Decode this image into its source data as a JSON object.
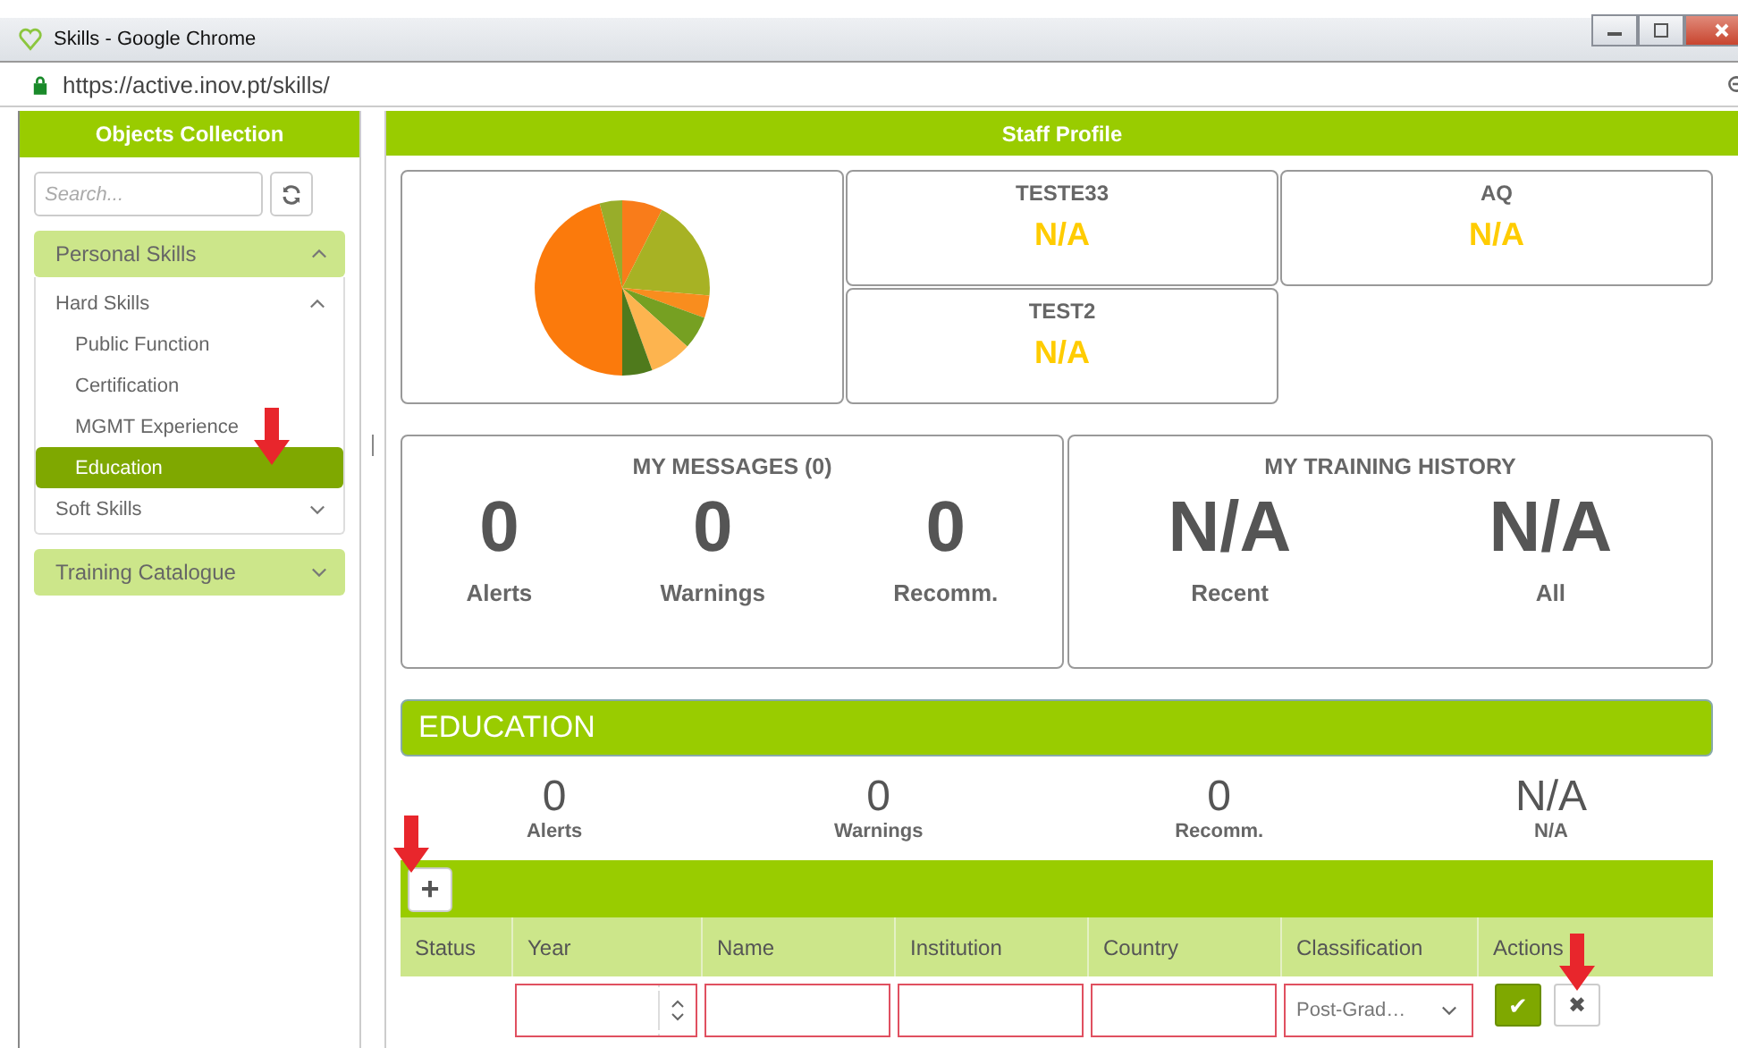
{
  "window": {
    "title": "Skills - Google Chrome",
    "url": "https://active.inov.pt/skills/"
  },
  "sidebar": {
    "title": "Objects Collection",
    "search": {
      "placeholder": "Search..."
    },
    "groups": [
      {
        "label": "Personal Skills",
        "expanded": true,
        "children": [
          {
            "label": "Hard Skills",
            "expanded": true,
            "children": [
              {
                "label": "Public Function",
                "selected": false
              },
              {
                "label": "Certification",
                "selected": false
              },
              {
                "label": "MGMT Experience",
                "selected": false
              },
              {
                "label": "Education",
                "selected": true
              }
            ]
          },
          {
            "label": "Soft Skills",
            "expanded": false
          }
        ]
      },
      {
        "label": "Training Catalogue",
        "expanded": false
      }
    ]
  },
  "profile": {
    "title": "Staff Profile",
    "indicators": [
      {
        "name": "TESTE33",
        "value": "N/A"
      },
      {
        "name": "AQ",
        "value": "N/A"
      },
      {
        "name": "TEST2",
        "value": "N/A"
      }
    ],
    "messages": {
      "title": "MY MESSAGES (0)",
      "stats": [
        {
          "value": "0",
          "label": "Alerts"
        },
        {
          "value": "0",
          "label": "Warnings"
        },
        {
          "value": "0",
          "label": "Recomm."
        }
      ]
    },
    "training": {
      "title": "MY TRAINING HISTORY",
      "stats": [
        {
          "value": "N/A",
          "label": "Recent"
        },
        {
          "value": "N/A",
          "label": "All"
        }
      ]
    }
  },
  "education": {
    "title": "EDUCATION",
    "stats": [
      {
        "value": "0",
        "label": "Alerts"
      },
      {
        "value": "0",
        "label": "Warnings"
      },
      {
        "value": "0",
        "label": "Recomm."
      },
      {
        "value": "N/A",
        "label": "N/A"
      }
    ],
    "add_button": "+",
    "columns": [
      "Status",
      "Year",
      "Name",
      "Institution",
      "Country",
      "Classification",
      "Actions"
    ],
    "new_row": {
      "classification": "Post-Grad…",
      "save": "✔",
      "cancel": "✖"
    }
  }
}
